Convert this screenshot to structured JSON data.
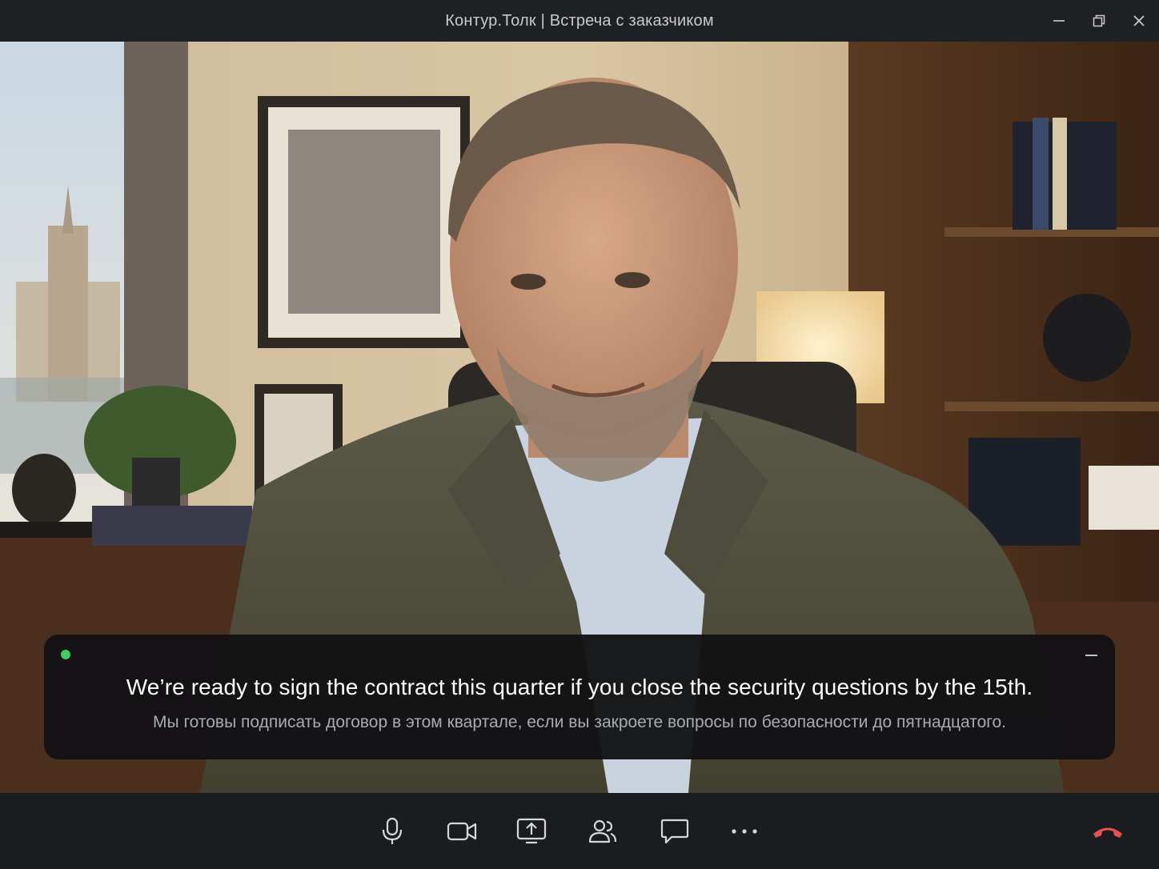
{
  "window": {
    "title": "Контур.Толк | Встреча с заказчиком",
    "controls": [
      "minimize-icon",
      "restore-icon",
      "close-icon"
    ]
  },
  "video": {
    "description_visible": false
  },
  "caption": {
    "status_color": "#3ecf5c",
    "original_text": "We’re ready to sign the contract this quarter if you close the security questions by the 15th.",
    "translated_text": "Мы готовы подписать договор в этом квартале, если вы закроете вопросы по безопасности до пятнадцатого."
  },
  "toolbar": {
    "buttons": [
      "microphone-icon",
      "camera-icon",
      "share-screen-icon",
      "participants-icon",
      "chat-icon",
      "more-icon"
    ],
    "end_call": "hang-up-icon",
    "end_call_color": "#e5534b"
  }
}
